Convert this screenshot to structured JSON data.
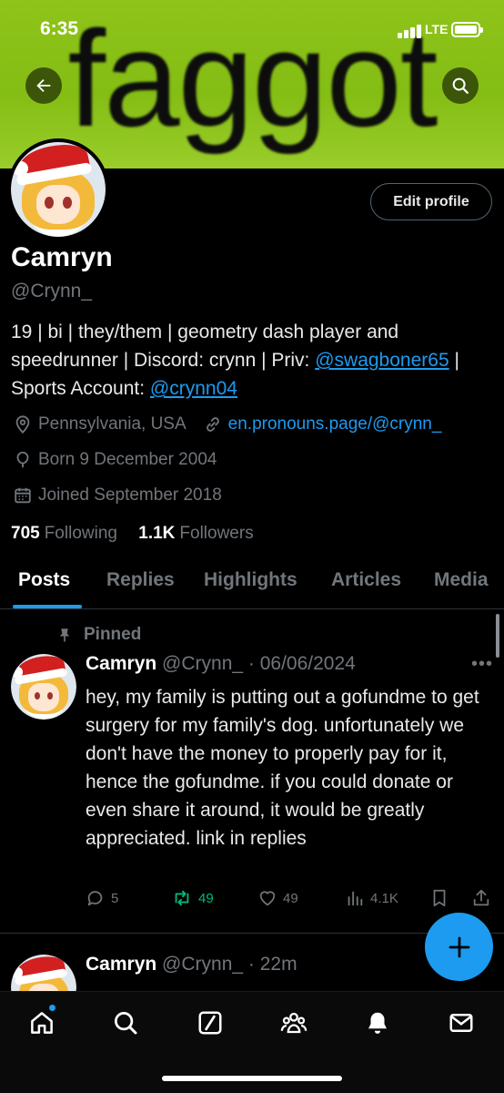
{
  "status_bar": {
    "time": "6:35",
    "network": "LTE"
  },
  "banner": {
    "text": "faggot"
  },
  "profile": {
    "edit_button": "Edit profile",
    "name": "Camryn",
    "handle": "@Crynn_",
    "bio": {
      "line1": "19 | bi | they/them | geometry dash player and speedrunner | Discord: crynn | Priv:",
      "priv_link": "@swagboner65",
      "mid": " | Sports Account: ",
      "sports_link": "@crynn04"
    },
    "location": "Pennsylvania, USA",
    "website": "en.pronouns.page/@crynn_",
    "born": "Born 9 December 2004",
    "joined": "Joined September 2018",
    "following_count": "705",
    "following_label": "Following",
    "followers_count": "1.1K",
    "followers_label": "Followers"
  },
  "tabs": [
    "Posts",
    "Replies",
    "Highlights",
    "Articles",
    "Media"
  ],
  "pinned_post": {
    "pinned_label": "Pinned",
    "name": "Camryn",
    "meta": "@Crynn_ · 06/06/2024",
    "text": "hey, my family is putting out a gofundme to get surgery for my family's dog. unfortunately we don't have the money to properly pay for it, hence the gofundme. if you could donate or even share it around, it would be greatly appreciated. link in replies",
    "replies": "5",
    "reposts": "49",
    "likes": "49",
    "views": "4.1K"
  },
  "second_post": {
    "name": "Camryn",
    "meta": "@Crynn_ · 22m"
  },
  "colors": {
    "accent": "#1d9bf0",
    "repost_green": "#00ba7c",
    "banner_green": "#8fc41a"
  }
}
